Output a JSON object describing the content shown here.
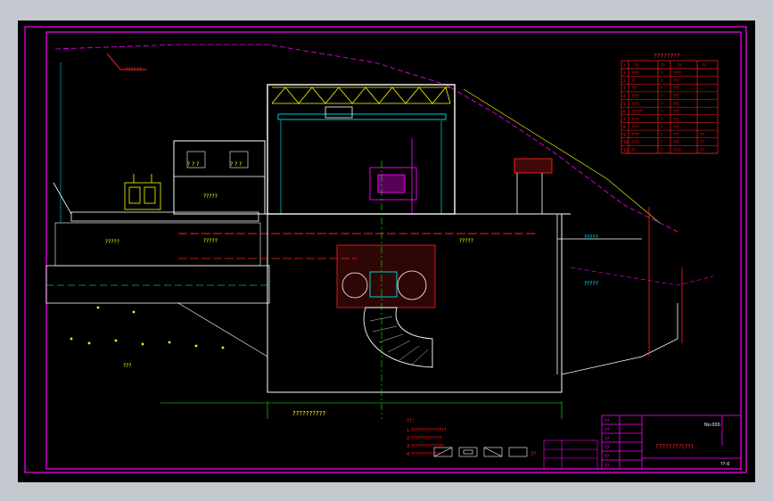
{
  "labels": {
    "top_left": "??????",
    "river_note": "??",
    "house_a": "? ? ?",
    "house_b": "? ? ?",
    "house_c": "?????",
    "bay": "?????",
    "gen_room": "?????",
    "left_floor": "?????",
    "water_line": "?????",
    "upper_right": "?????",
    "bottom_center": "??????????",
    "lower_left": "???",
    "table_title": "????????",
    "notes_title": "??:",
    "legend_tail": "??"
  },
  "notes": [
    "1.???????????????",
    "2.?????????????",
    "3.??????????????",
    "4.????????????"
  ],
  "spec_table": {
    "header": [
      "?",
      "??",
      "??",
      "??",
      "??"
    ],
    "rows": [
      [
        "1",
        "????",
        "?",
        "????",
        ""
      ],
      [
        "2",
        "??",
        "?",
        "???",
        ""
      ],
      [
        "3",
        "???",
        "?",
        "???",
        ""
      ],
      [
        "4",
        "????",
        "?",
        "???",
        ""
      ],
      [
        "5",
        "????",
        "?",
        "???",
        ""
      ],
      [
        "6",
        "??????",
        "?",
        "???",
        ""
      ],
      [
        "7",
        "????",
        "?",
        "???",
        ""
      ],
      [
        "8",
        "????",
        "?",
        "???",
        ""
      ],
      [
        "9",
        "????",
        "?",
        "???",
        "??"
      ],
      [
        "10",
        "????",
        "?",
        "???",
        "??"
      ],
      [
        "11",
        "??",
        "?",
        "????",
        "??"
      ]
    ]
  },
  "title_block": {
    "drawing_title": "????????(??)",
    "top_right": "No.000",
    "bottom_right": "??-0",
    "fields": [
      "??",
      "??",
      "??",
      "??",
      "??",
      "??"
    ]
  },
  "colors": {
    "frame": "#ff00ff",
    "structure": "#ffffff",
    "dims": "#00ff00",
    "red": "#ff2020",
    "yellow": "#ffff00",
    "cyan": "#00ffff",
    "magenta": "#ff00ff",
    "pink": "#ff44ff"
  }
}
